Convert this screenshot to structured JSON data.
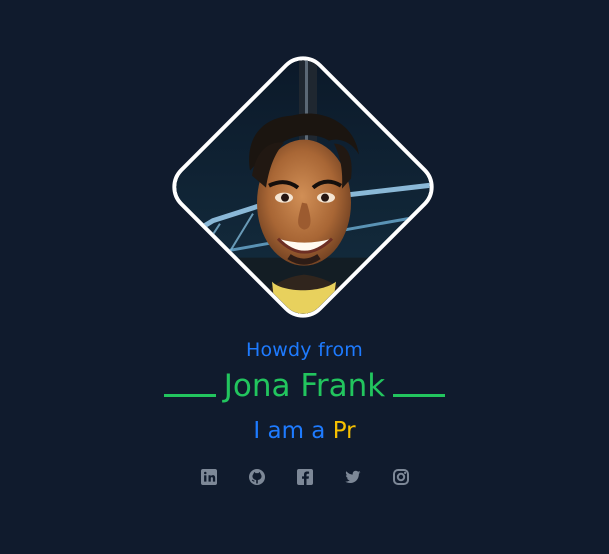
{
  "hero": {
    "greeting": "Howdy from",
    "name": "Jona Frank",
    "role_prefix": "I am a",
    "role_typed": "Pr"
  },
  "avatar": {
    "alt": "Jona Frank profile photo"
  },
  "social_links": [
    {
      "icon": "linkedin-icon",
      "label": "LinkedIn"
    },
    {
      "icon": "github-icon",
      "label": "GitHub"
    },
    {
      "icon": "facebook-icon",
      "label": "Facebook"
    },
    {
      "icon": "twitter-icon",
      "label": "Twitter"
    },
    {
      "icon": "instagram-icon",
      "label": "Instagram"
    }
  ],
  "colors": {
    "background": "#101b2d",
    "greeting": "#1e7bff",
    "name": "#22c55e",
    "typed_text": "#f6c000",
    "social_icons": "#7d8897",
    "avatar_border": "#ffffff"
  }
}
